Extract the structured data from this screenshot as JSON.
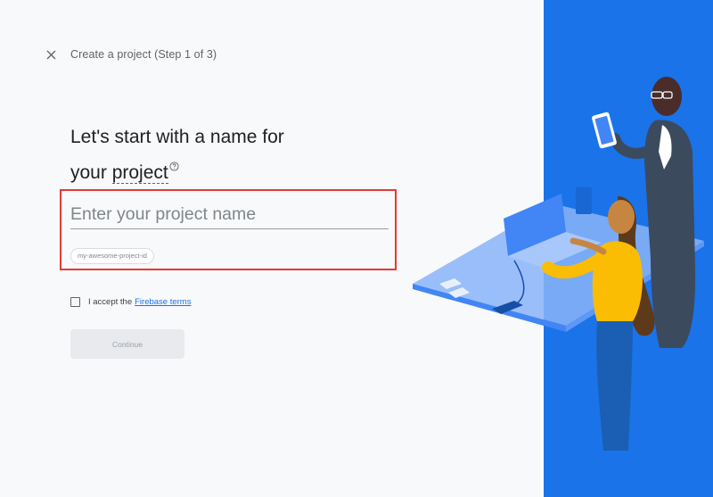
{
  "header": {
    "close_icon": "close-icon",
    "step_title": "Create a project (Step 1 of 3)"
  },
  "main": {
    "heading_line1": "Let's start with a name for",
    "heading_line2_prefix": "your ",
    "heading_line2_link": "project",
    "help_icon": "help-circle-icon",
    "name_input": {
      "value": "",
      "placeholder": "Enter your project name"
    },
    "project_id_chip": "my-awesome-project-id",
    "terms": {
      "checked": false,
      "text": "I accept the",
      "link": "Firebase terms"
    },
    "continue_label": "Continue"
  },
  "colors": {
    "accent": "#1a73e8",
    "highlight": "#e53935",
    "background": "#f8f9fa",
    "button_disabled": "#e8eaed"
  },
  "illustration": {
    "description_icon": "firebase-project-illustration"
  }
}
